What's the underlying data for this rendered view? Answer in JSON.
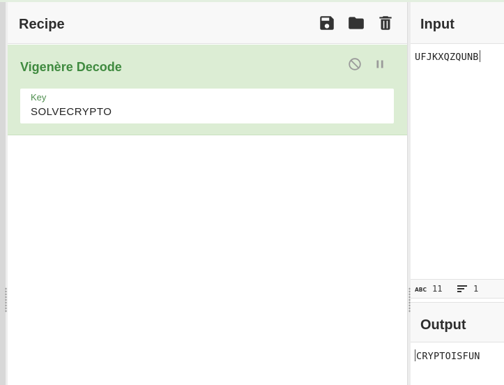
{
  "recipe": {
    "title": "Recipe",
    "icons": [
      "save-icon",
      "folder-icon",
      "trash-icon"
    ]
  },
  "operation": {
    "name": "Vigenère Decode",
    "icons": [
      "disable-icon",
      "pause-icon"
    ],
    "arguments": [
      {
        "label": "Key",
        "value": "SOLVECRYPTO"
      }
    ]
  },
  "input": {
    "title": "Input",
    "value": "UFJKXQZQUNB",
    "stats": {
      "length_icon": "abc-icon",
      "length": "11",
      "lines_icon": "lines-icon",
      "lines": "1"
    }
  },
  "output": {
    "title": "Output",
    "value": "CRYPTOISFUN"
  },
  "colors": {
    "operation_bg": "#dcedd4",
    "operation_title": "#3f8a3f",
    "header_bg": "#f8f8f8",
    "icon": "#333333"
  }
}
